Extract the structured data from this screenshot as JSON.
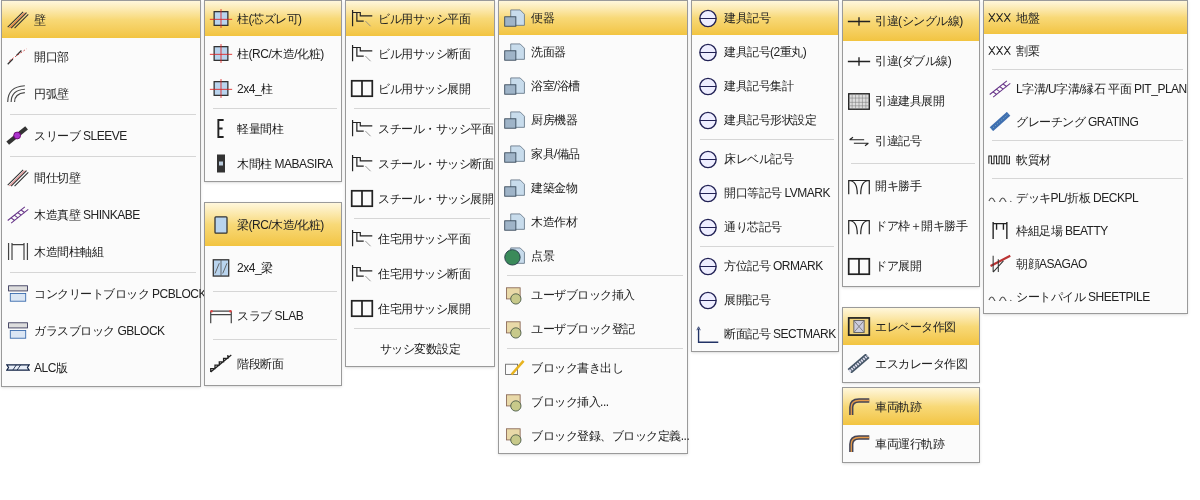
{
  "columns": [
    {
      "menus": [
        {
          "groups": [
            [
              {
                "label": "壁",
                "selected": true,
                "kind": "icon"
              },
              {
                "label": "開口部",
                "selected": false,
                "kind": "icon"
              },
              {
                "label": "円弧壁",
                "selected": false,
                "kind": "icon"
              }
            ],
            [
              {
                "label": "スリーブ SLEEVE",
                "selected": false,
                "kind": "icon"
              }
            ],
            [
              {
                "label": "間仕切壁",
                "selected": false,
                "kind": "icon"
              },
              {
                "label": "木造真壁 SHINKABE",
                "selected": false,
                "kind": "icon"
              },
              {
                "label": "木造間柱軸組",
                "selected": false,
                "kind": "icon"
              }
            ],
            [
              {
                "label": "コンクリートブロック PCBLOCK",
                "selected": false,
                "kind": "icon"
              },
              {
                "label": "ガラスブロック GBLOCK",
                "selected": false,
                "kind": "icon"
              },
              {
                "label": "ALC版",
                "selected": false,
                "kind": "icon"
              }
            ]
          ]
        }
      ]
    },
    {
      "menus": [
        {
          "groups": [
            [
              {
                "label": "柱(芯ズレ可)",
                "selected": true,
                "kind": "icon"
              },
              {
                "label": "柱(RC/木造/化粧)",
                "selected": false,
                "kind": "icon"
              },
              {
                "label": "2x4_柱",
                "selected": false,
                "kind": "icon"
              }
            ],
            [
              {
                "label": "軽量間柱",
                "selected": false,
                "kind": "icon"
              },
              {
                "label": "木間柱 MABASIRA",
                "selected": false,
                "kind": "icon"
              }
            ]
          ]
        },
        {
          "groups": [
            [
              {
                "label": "梁(RC/木造/化粧)",
                "selected": true,
                "kind": "icon"
              },
              {
                "label": "2x4_梁",
                "selected": false,
                "kind": "icon"
              }
            ],
            [
              {
                "label": "スラブ SLAB",
                "selected": false,
                "kind": "icon"
              }
            ],
            [
              {
                "label": "階段断面",
                "selected": false,
                "kind": "icon"
              }
            ]
          ]
        }
      ]
    },
    {
      "menus": [
        {
          "groups": [
            [
              {
                "label": "ビル用サッシ平面",
                "selected": true,
                "kind": "icon"
              },
              {
                "label": "ビル用サッシ断面",
                "selected": false,
                "kind": "icon"
              },
              {
                "label": "ビル用サッシ展開",
                "selected": false,
                "kind": "icon"
              }
            ],
            [
              {
                "label": "スチール・サッシ平面",
                "selected": false,
                "kind": "icon"
              },
              {
                "label": "スチール・サッシ断面",
                "selected": false,
                "kind": "icon"
              },
              {
                "label": "スチール・サッシ展開",
                "selected": false,
                "kind": "icon"
              }
            ],
            [
              {
                "label": "住宅用サッシ平面",
                "selected": false,
                "kind": "icon"
              },
              {
                "label": "住宅用サッシ断面",
                "selected": false,
                "kind": "icon"
              },
              {
                "label": "住宅用サッシ展開",
                "selected": false,
                "kind": "icon"
              }
            ],
            [
              {
                "label": "サッシ変数設定",
                "selected": false,
                "kind": "plain"
              }
            ]
          ]
        }
      ]
    },
    {
      "menus": [
        {
          "groups": [
            [
              {
                "label": "便器",
                "selected": true,
                "kind": "icon"
              },
              {
                "label": "洗面器",
                "selected": false,
                "kind": "icon"
              },
              {
                "label": "浴室/浴槽",
                "selected": false,
                "kind": "icon"
              },
              {
                "label": "厨房機器",
                "selected": false,
                "kind": "icon"
              },
              {
                "label": "家具/備品",
                "selected": false,
                "kind": "icon"
              },
              {
                "label": "建築金物",
                "selected": false,
                "kind": "icon"
              },
              {
                "label": "木造作材",
                "selected": false,
                "kind": "icon"
              },
              {
                "label": "点景",
                "selected": false,
                "kind": "icon"
              }
            ],
            [
              {
                "label": "ユーザブロック挿入",
                "selected": false,
                "kind": "icon"
              },
              {
                "label": "ユーザブロック登記",
                "selected": false,
                "kind": "icon"
              }
            ],
            [
              {
                "label": "ブロック書き出し",
                "selected": false,
                "kind": "icon"
              },
              {
                "label": "ブロック挿入...",
                "selected": false,
                "kind": "icon"
              },
              {
                "label": "ブロック登録、ブロック定義...",
                "selected": false,
                "kind": "icon"
              }
            ]
          ]
        }
      ]
    },
    {
      "menus": [
        {
          "groups": [
            [
              {
                "label": "建具記号",
                "selected": true,
                "kind": "icon"
              },
              {
                "label": "建具記号(2重丸)",
                "selected": false,
                "kind": "icon"
              },
              {
                "label": "建具記号集計",
                "selected": false,
                "kind": "icon"
              },
              {
                "label": "建具記号形状設定",
                "selected": false,
                "kind": "icon"
              }
            ],
            [
              {
                "label": "床レベル記号",
                "selected": false,
                "kind": "icon"
              },
              {
                "label": "開口等記号 LVMARK",
                "selected": false,
                "kind": "icon"
              },
              {
                "label": "通り芯記号",
                "selected": false,
                "kind": "icon"
              }
            ],
            [
              {
                "label": "方位記号 ORMARK",
                "selected": false,
                "kind": "icon"
              },
              {
                "label": "展開記号",
                "selected": false,
                "kind": "icon"
              },
              {
                "label": "断面記号 SECTMARK",
                "selected": false,
                "kind": "icon"
              }
            ]
          ]
        }
      ]
    },
    {
      "menus": [
        {
          "groups": [
            [
              {
                "label": "引違(シングル線)",
                "selected": true,
                "kind": "icon"
              },
              {
                "label": "引違(ダブル線)",
                "selected": false,
                "kind": "icon"
              },
              {
                "label": "引違建具展開",
                "selected": false,
                "kind": "icon"
              },
              {
                "label": "引違記号",
                "selected": false,
                "kind": "icon"
              }
            ],
            [
              {
                "label": "開キ勝手",
                "selected": false,
                "kind": "icon"
              },
              {
                "label": "ドア枠＋開キ勝手",
                "selected": false,
                "kind": "icon"
              },
              {
                "label": "ドア展開",
                "selected": false,
                "kind": "icon"
              }
            ]
          ]
        },
        {
          "groups": [
            [
              {
                "label": "エレベータ作図",
                "selected": true,
                "kind": "icon"
              },
              {
                "label": "エスカレータ作図",
                "selected": false,
                "kind": "icon"
              }
            ]
          ]
        },
        {
          "groups": [
            [
              {
                "label": "車両軌跡",
                "selected": true,
                "kind": "icon"
              },
              {
                "label": "車両運行軌跡",
                "selected": false,
                "kind": "icon"
              }
            ]
          ]
        }
      ]
    },
    {
      "menus": [
        {
          "groups": [
            [
              {
                "label": "地盤",
                "selected": true,
                "kind": "icon"
              },
              {
                "label": "割栗",
                "selected": false,
                "kind": "icon"
              }
            ],
            [
              {
                "label": "L字溝/U字溝/縁石 平面 PIT_PLAN",
                "selected": false,
                "kind": "icon"
              },
              {
                "label": "グレーチング GRATING",
                "selected": false,
                "kind": "icon"
              }
            ],
            [
              {
                "label": "軟質材",
                "selected": false,
                "kind": "icon"
              }
            ],
            [
              {
                "label": "デッキPL/折板 DECKPL",
                "selected": false,
                "kind": "icon"
              },
              {
                "label": "枠組足場 BEATTY",
                "selected": false,
                "kind": "icon"
              },
              {
                "label": "朝顔ASAGAO",
                "selected": false,
                "kind": "icon"
              },
              {
                "label": "シートパイル SHEETPILE",
                "selected": false,
                "kind": "icon"
              }
            ]
          ]
        }
      ]
    }
  ]
}
